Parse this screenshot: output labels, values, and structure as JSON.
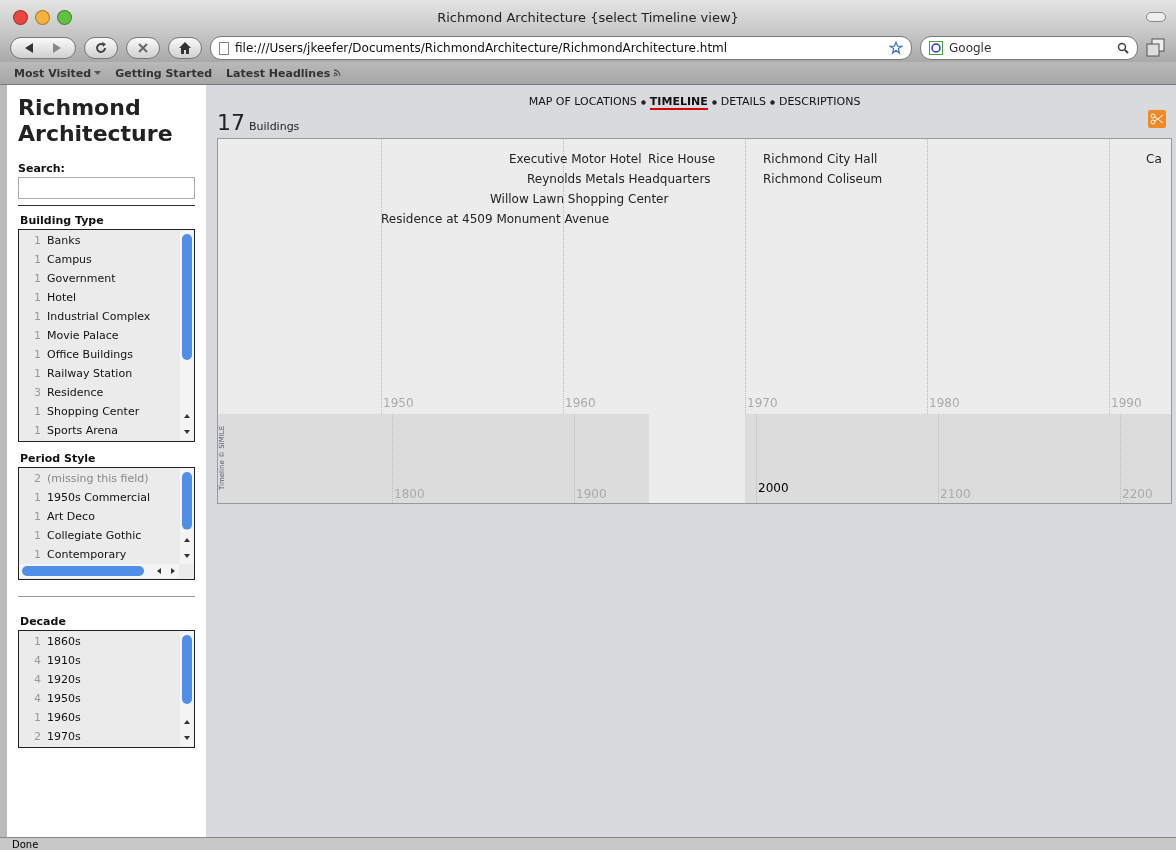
{
  "window": {
    "title": "Richmond Architecture {select Timeline view}"
  },
  "toolbar": {
    "url": "file:///Users/jkeefer/Documents/RichmondArchitecture/RichmondArchitecture.html",
    "search_placeholder": "Google"
  },
  "bookmarks": [
    {
      "label": "Most Visited",
      "kind": "menu"
    },
    {
      "label": "Getting Started",
      "kind": "link"
    },
    {
      "label": "Latest Headlines",
      "kind": "feed"
    }
  ],
  "sidebar": {
    "title": "Richmond Architecture",
    "search_label": "Search:",
    "facets": [
      {
        "title": "Building Type",
        "hscroll": false,
        "items": [
          {
            "count": "1",
            "label": "Banks",
            "kind": "value"
          },
          {
            "count": "1",
            "label": "Campus",
            "kind": "value"
          },
          {
            "count": "1",
            "label": "Government",
            "kind": "value"
          },
          {
            "count": "1",
            "label": "Hotel",
            "kind": "value"
          },
          {
            "count": "1",
            "label": "Industrial Complex",
            "kind": "value"
          },
          {
            "count": "1",
            "label": "Movie Palace",
            "kind": "value"
          },
          {
            "count": "1",
            "label": "Office Buildings",
            "kind": "value"
          },
          {
            "count": "1",
            "label": "Railway Station",
            "kind": "value"
          },
          {
            "count": "3",
            "label": "Residence",
            "kind": "value"
          },
          {
            "count": "1",
            "label": "Shopping Center",
            "kind": "value"
          },
          {
            "count": "1",
            "label": "Sports Arena",
            "kind": "value"
          }
        ]
      },
      {
        "title": "Period Style",
        "hscroll": true,
        "items": [
          {
            "count": "2",
            "label": "(missing this field)",
            "kind": "missing"
          },
          {
            "count": "1",
            "label": "1950s Commercial",
            "kind": "value"
          },
          {
            "count": "1",
            "label": "Art Deco",
            "kind": "value"
          },
          {
            "count": "1",
            "label": "Collegiate Gothic",
            "kind": "value"
          },
          {
            "count": "1",
            "label": "Contemporary",
            "kind": "value"
          }
        ]
      },
      {
        "title": "Decade",
        "hscroll": false,
        "items": [
          {
            "count": "1",
            "label": "1860s",
            "kind": "value"
          },
          {
            "count": "4",
            "label": "1910s",
            "kind": "value"
          },
          {
            "count": "4",
            "label": "1920s",
            "kind": "value"
          },
          {
            "count": "4",
            "label": "1950s",
            "kind": "value"
          },
          {
            "count": "1",
            "label": "1960s",
            "kind": "value"
          },
          {
            "count": "2",
            "label": "1970s",
            "kind": "value"
          }
        ]
      }
    ]
  },
  "views": [
    {
      "label": "MAP OF LOCATIONS",
      "selected": false
    },
    {
      "label": "TIMELINE",
      "selected": true
    },
    {
      "label": "DETAILS",
      "selected": false
    },
    {
      "label": "DESCRIPTIONS",
      "selected": false
    }
  ],
  "results": {
    "count": "17",
    "unit": "Buildings"
  },
  "timeline": {
    "events": [
      {
        "label": "Executive Motor Hotel"
      },
      {
        "label": "Rice House"
      },
      {
        "label": "Richmond City Hall"
      },
      {
        "label": "Ca"
      },
      {
        "label": "Reynolds Metals Headquarters"
      },
      {
        "label": "Richmond Coliseum"
      },
      {
        "label": "Willow Lawn Shopping Center"
      },
      {
        "label": "Residence at 4509 Monument Avenue"
      }
    ],
    "upper_ticks": [
      {
        "label": "1950"
      },
      {
        "label": "1960"
      },
      {
        "label": "1970"
      },
      {
        "label": "1980"
      },
      {
        "label": "1990"
      }
    ],
    "lower_ticks": [
      {
        "label": "1800",
        "kind": "tick"
      },
      {
        "label": "1900",
        "kind": "tick"
      },
      {
        "label": "2000",
        "kind": "current"
      },
      {
        "label": "2100",
        "kind": "tick"
      },
      {
        "label": "2200",
        "kind": "tick"
      }
    ],
    "credit": "Timeline © SIMILE"
  },
  "status_bar": "Done"
}
